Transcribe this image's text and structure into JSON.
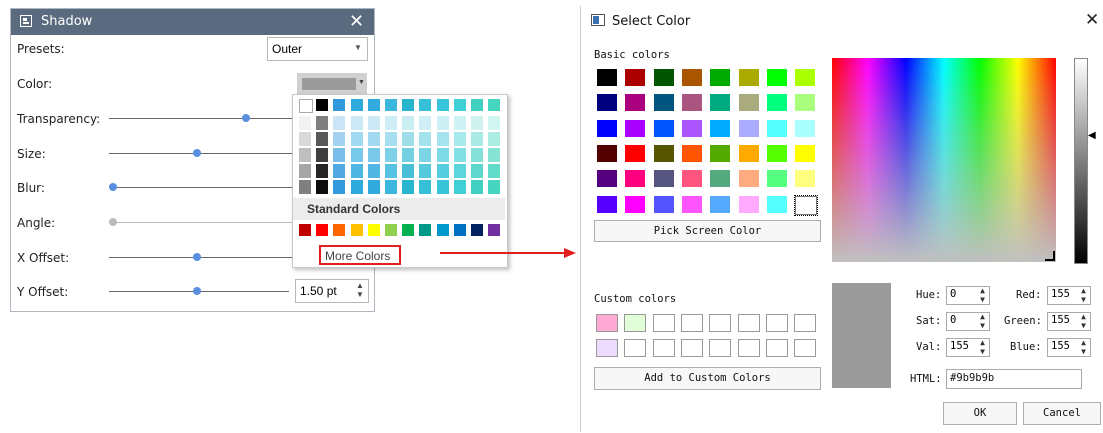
{
  "shadow_panel": {
    "title": "Shadow",
    "rows": [
      {
        "label": "Presets:"
      },
      {
        "label": "Color:"
      },
      {
        "label": "Transparency:"
      },
      {
        "label": "Size:"
      },
      {
        "label": "Blur:"
      },
      {
        "label": "Angle:"
      },
      {
        "label": "X Offset:"
      },
      {
        "label": "Y Offset:"
      }
    ],
    "presets_value": "Outer",
    "y_offset_value": "1.50 pt",
    "color_value": "#9b9b9b"
  },
  "color_popup": {
    "standard_title": "Standard Colors",
    "more_colors_label": "More Colors",
    "top_row": [
      "#ffffff",
      "#000000",
      "#3399dd",
      "#2faadd",
      "#33aadd",
      "#3bb7dd",
      "#2ab5cf",
      "#36bfd6",
      "#38c4d9",
      "#3fcfd4",
      "#42d0c3",
      "#46d6bf"
    ],
    "standard_colors": [
      "#c00000",
      "#ff0000",
      "#ff6600",
      "#ffc000",
      "#ffff00",
      "#92d050",
      "#00b050",
      "#009a8a",
      "#0099cc",
      "#0070c0",
      "#002060",
      "#7030a0"
    ]
  },
  "select_color": {
    "title": "Select Color",
    "basic_colors_label": "Basic colors",
    "basic_colors": [
      [
        "#000000",
        "#aa0000",
        "#005500",
        "#aa5500",
        "#00aa00",
        "#aaaa00",
        "#00ff00",
        "#aaff00"
      ],
      [
        "#00007f",
        "#aa007f",
        "#00557f",
        "#aa557f",
        "#00aa7f",
        "#aaaa7f",
        "#00ff7f",
        "#aaff7f"
      ],
      [
        "#0000ff",
        "#aa00ff",
        "#0055ff",
        "#aa55ff",
        "#00aaff",
        "#aaaaff",
        "#55ffff",
        "#aaffff"
      ],
      [
        "#550000",
        "#ff0000",
        "#555500",
        "#ff5500",
        "#55aa00",
        "#ffaa00",
        "#55ff00",
        "#ffff00"
      ],
      [
        "#55007f",
        "#ff007f",
        "#55557f",
        "#ff557f",
        "#55aa7f",
        "#ffaa7f",
        "#55ff7f",
        "#ffff7f"
      ],
      [
        "#5500ff",
        "#ff00ff",
        "#5555ff",
        "#ff55ff",
        "#55aaff",
        "#ffaaff",
        "#55ffff",
        "#ffffff"
      ]
    ],
    "pick_screen_label": "Pick Screen Color",
    "custom_colors_label": "Custom colors",
    "custom_colors": [
      [
        "#ffaad4",
        "#e0ffd8",
        "#ffffff",
        "#ffffff",
        "#ffffff",
        "#ffffff",
        "#ffffff",
        "#ffffff"
      ],
      [
        "#eedcff",
        "#ffffff",
        "#ffffff",
        "#ffffff",
        "#ffffff",
        "#ffffff",
        "#ffffff",
        "#ffffff"
      ]
    ],
    "add_custom_label": "Add to Custom Colors",
    "hue_label": "Hue:",
    "hue_value": "0",
    "sat_label": "Sat:",
    "sat_value": "0",
    "val_label": "Val:",
    "val_value": "155",
    "red_label": "Red:",
    "red_value": "155",
    "green_label": "Green:",
    "green_value": "155",
    "blue_label": "Blue:",
    "blue_value": "155",
    "html_label": "HTML:",
    "html_value": "#9b9b9b",
    "ok_label": "OK",
    "cancel_label": "Cancel",
    "current_color": "#9b9b9b"
  }
}
